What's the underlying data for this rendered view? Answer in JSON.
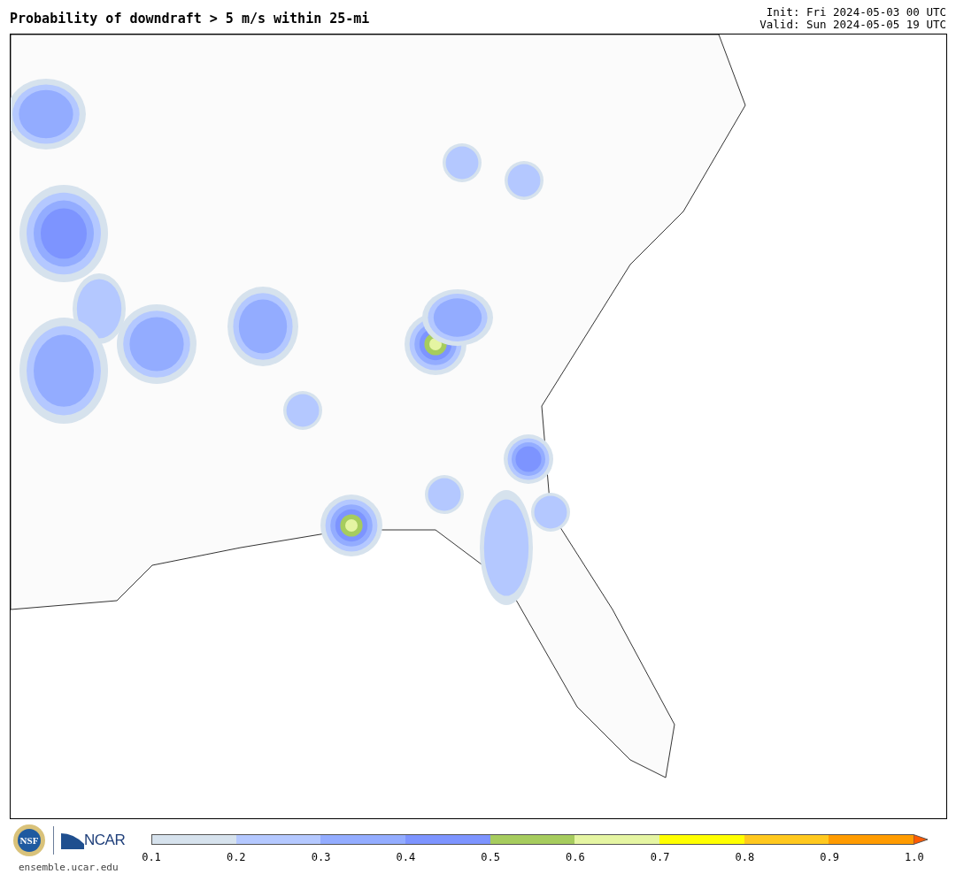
{
  "title": "Probability of downdraft > 5 m/s within 25-mi",
  "run_info": [
    "Init: Fri 2024-05-03 00 UTC",
    "Valid: Sun 2024-05-05 19 UTC"
  ],
  "logos": {
    "nsf": "NSF",
    "ncar": "NCAR",
    "site": "ensemble.ucar.edu"
  },
  "colorbar": {
    "bins": [
      {
        "kind": "bin",
        "color": "#d6e2ed"
      },
      {
        "kind": "bin",
        "color": "#b4c8ff"
      },
      {
        "kind": "bin",
        "color": "#93acff"
      },
      {
        "kind": "bin",
        "color": "#7d94ff"
      },
      {
        "kind": "bin",
        "color": "#a6cc5e"
      },
      {
        "kind": "bin",
        "color": "#e5f5a2"
      },
      {
        "kind": "bin",
        "color": "#ffff00"
      },
      {
        "kind": "bin",
        "color": "#ffc81e"
      },
      {
        "kind": "bin",
        "color": "#ff9b00"
      },
      {
        "kind": "arrow",
        "color": "#ff5a00"
      }
    ],
    "ticks": [
      "0.1",
      "0.2",
      "0.3",
      "0.4",
      "0.5",
      "0.6",
      "0.7",
      "0.8",
      "0.9",
      "1.0"
    ]
  }
}
